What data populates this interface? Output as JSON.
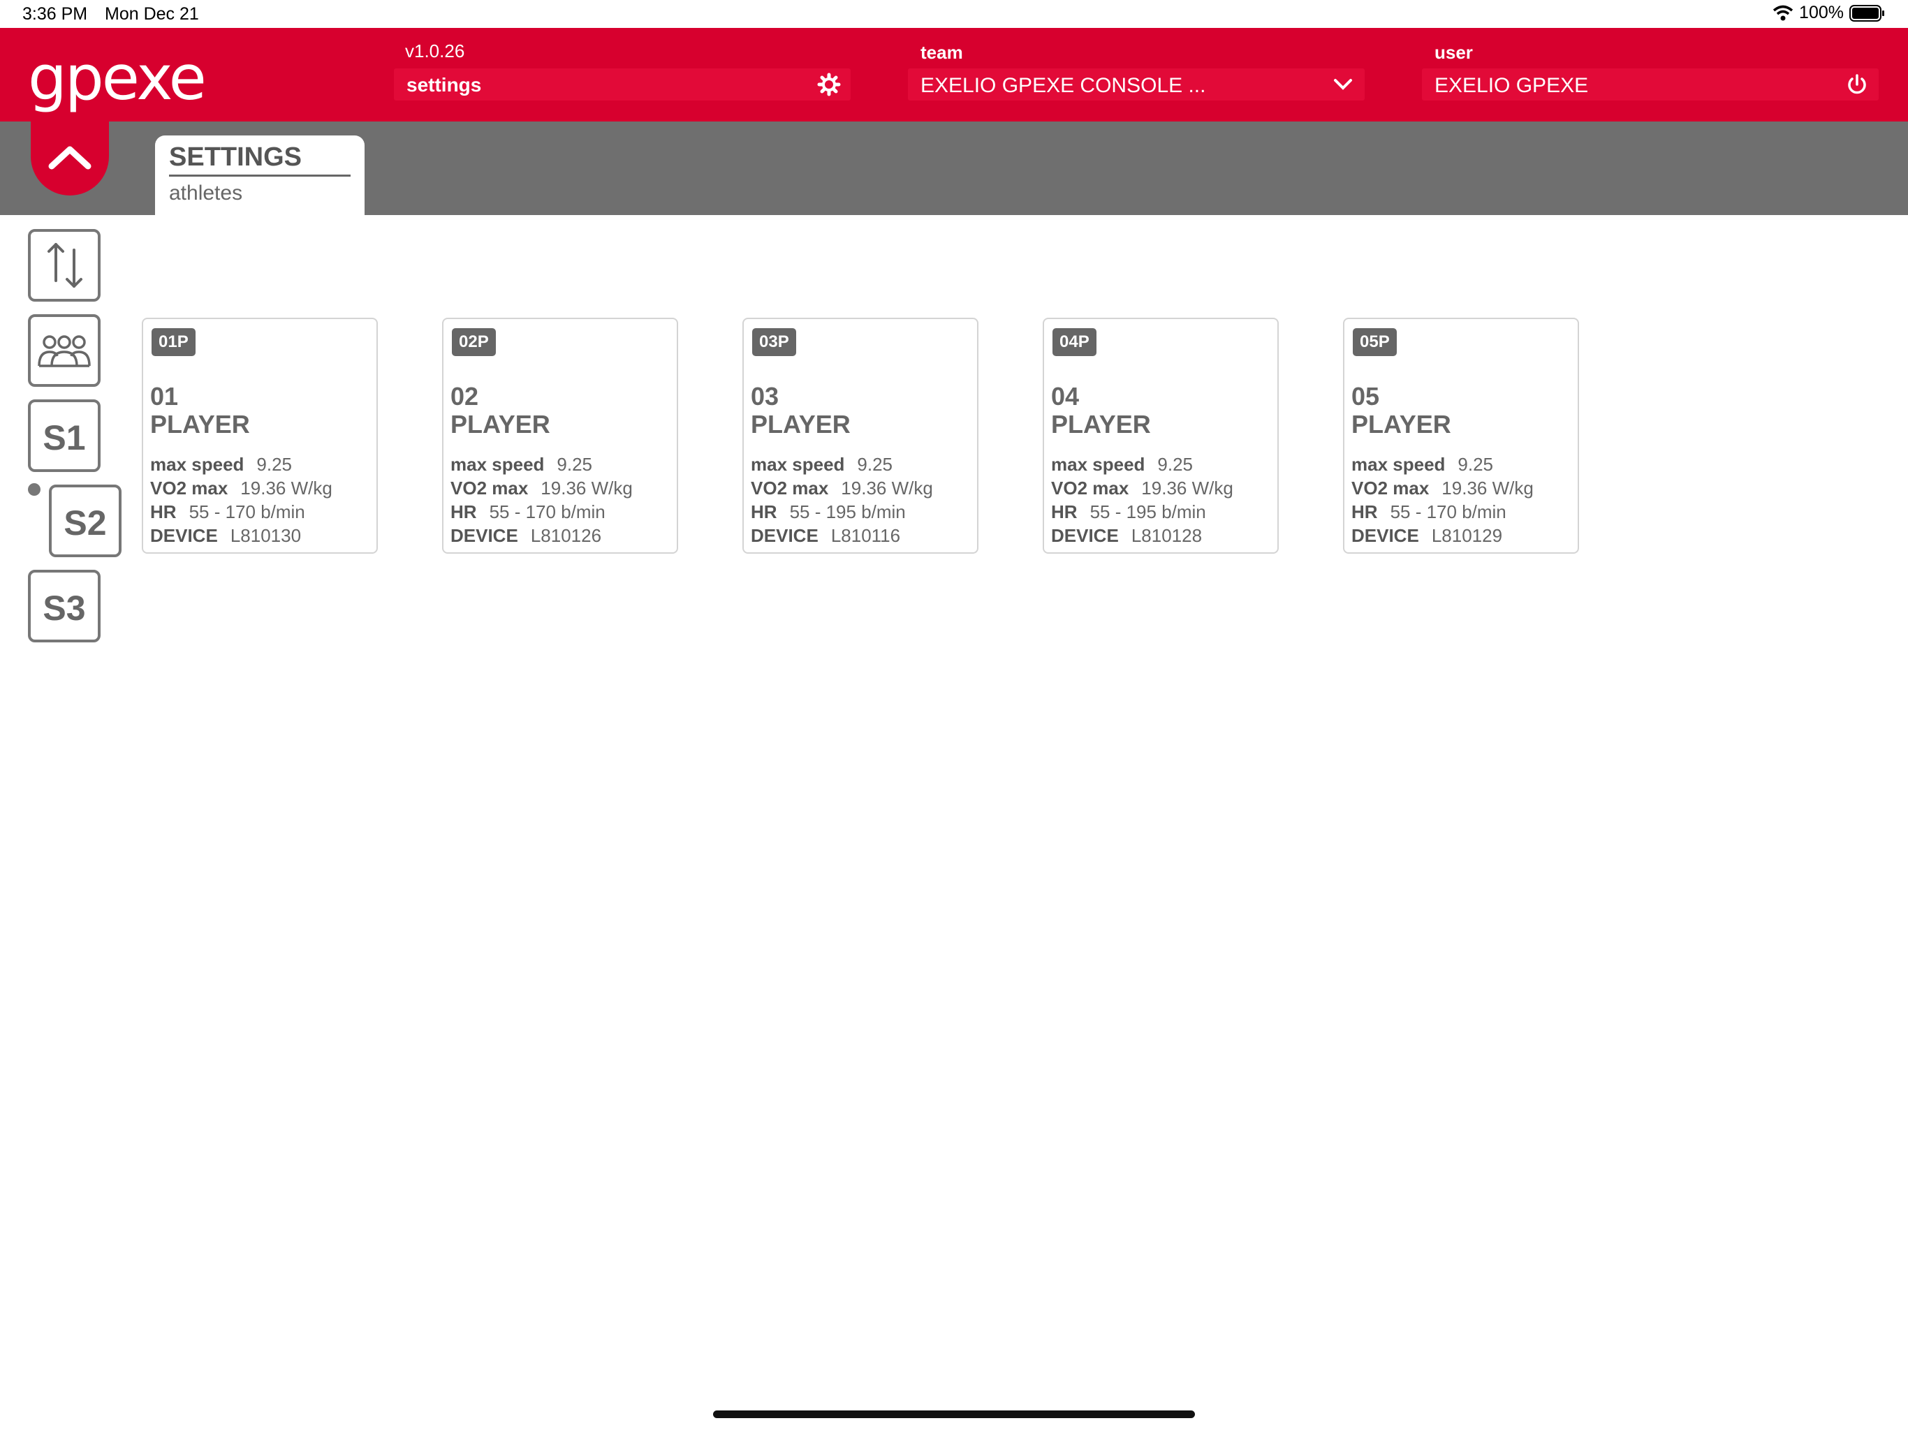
{
  "status_bar": {
    "time": "3:36 PM",
    "date": "Mon Dec 21",
    "battery": "100%"
  },
  "header": {
    "logo": "gpexe",
    "version": "v1.0.26",
    "settings_label": "settings",
    "team_label": "team",
    "team_value": "EXELIO GPEXE CONSOLE ...",
    "user_label": "user",
    "user_value": "EXELIO GPEXE"
  },
  "tab": {
    "title": "SETTINGS",
    "subtitle": "athletes"
  },
  "rail": {
    "s1": "S1",
    "s2": "S2",
    "s3": "S3"
  },
  "field_labels": {
    "max_speed": "max speed",
    "vo2": "VO2 max",
    "hr": "HR",
    "device": "DEVICE"
  },
  "athletes": [
    {
      "badge": "01P",
      "number": "01",
      "name": "PLAYER",
      "max_speed": "9.25",
      "vo2": "19.36 W/kg",
      "hr": "55 - 170 b/min",
      "device": "L810130"
    },
    {
      "badge": "02P",
      "number": "02",
      "name": "PLAYER",
      "max_speed": "9.25",
      "vo2": "19.36 W/kg",
      "hr": "55 - 170 b/min",
      "device": "L810126"
    },
    {
      "badge": "03P",
      "number": "03",
      "name": "PLAYER",
      "max_speed": "9.25",
      "vo2": "19.36 W/kg",
      "hr": "55 - 195 b/min",
      "device": "L810116"
    },
    {
      "badge": "04P",
      "number": "04",
      "name": "PLAYER",
      "max_speed": "9.25",
      "vo2": "19.36 W/kg",
      "hr": "55 - 195 b/min",
      "device": "L810128"
    },
    {
      "badge": "05P",
      "number": "05",
      "name": "PLAYER",
      "max_speed": "9.25",
      "vo2": "19.36 W/kg",
      "hr": "55 - 170 b/min",
      "device": "L810129"
    }
  ],
  "colors": {
    "brand_red": "#d7002e",
    "band_gray": "#6f6f6f",
    "text_gray": "#666666"
  },
  "icons": [
    "gear-icon",
    "chevron-down-icon",
    "power-icon",
    "chevron-up-icon",
    "sort-arrows-icon",
    "team-group-icon",
    "wifi-icon",
    "battery-icon"
  ]
}
